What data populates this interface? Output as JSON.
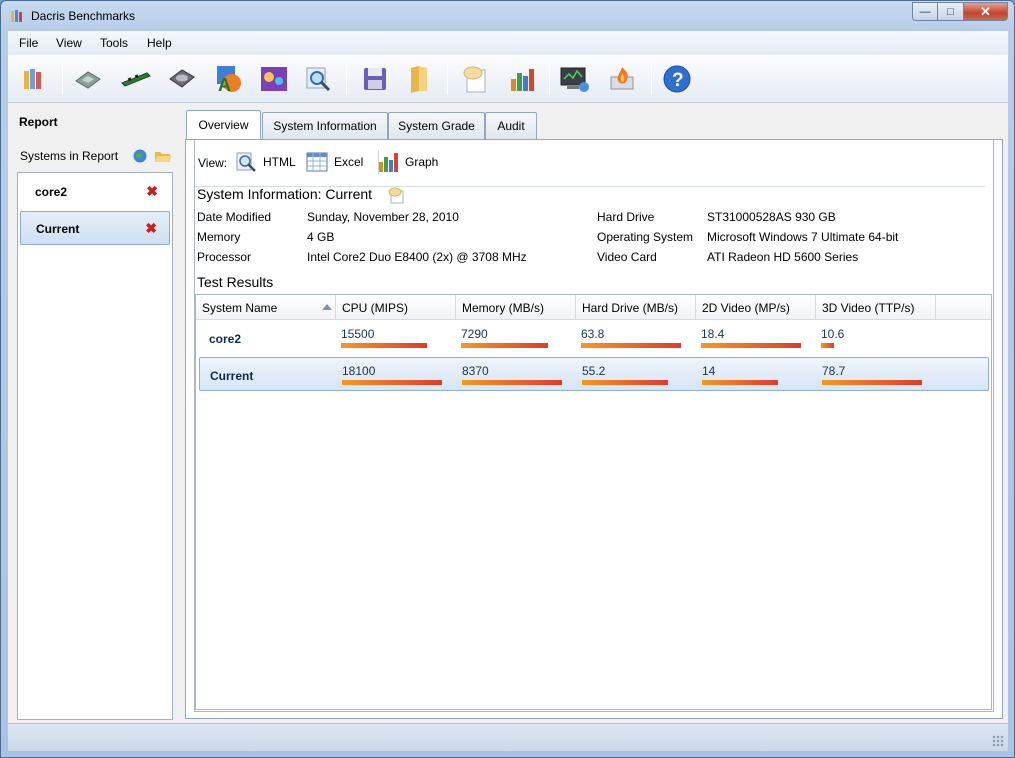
{
  "window": {
    "title": "Dacris Benchmarks"
  },
  "menu": {
    "file": "File",
    "view": "View",
    "tools": "Tools",
    "help": "Help"
  },
  "toolbar_icons": [
    "report-icon",
    "cpu-icon",
    "memory-icon",
    "hard-drive-icon",
    "2d-video-icon",
    "3d-video-icon",
    "search-icon",
    "save-icon",
    "open-folder-icon",
    "notes-icon",
    "graph-icon",
    "monitor-icon",
    "burn-in-icon",
    "help-icon"
  ],
  "left": {
    "title": "Report",
    "systems_label": "Systems in Report",
    "systems": [
      {
        "name": "core2",
        "selected": false
      },
      {
        "name": "Current",
        "selected": true
      }
    ]
  },
  "tabs": [
    "Overview",
    "System Information",
    "System Grade",
    "Audit"
  ],
  "view": {
    "label": "View:",
    "html": "HTML",
    "excel": "Excel",
    "graph": "Graph"
  },
  "sysinfo": {
    "title": "System Information: Current",
    "left": [
      {
        "label": "Date Modified",
        "value": "Sunday, November 28, 2010"
      },
      {
        "label": "Memory",
        "value": "4 GB"
      },
      {
        "label": "Processor",
        "value": "Intel Core2 Duo E8400 (2x) @ 3708 MHz"
      }
    ],
    "right": [
      {
        "label": "Hard Drive",
        "value": "ST31000528AS 930 GB"
      },
      {
        "label": "Operating System",
        "value": "Microsoft Windows 7 Ultimate 64-bit"
      },
      {
        "label": "Video Card",
        "value": "ATI Radeon HD 5600 Series"
      }
    ]
  },
  "results": {
    "title": "Test Results",
    "columns": [
      "System Name",
      "CPU (MIPS)",
      "Memory (MB/s)",
      "Hard Drive (MB/s)",
      "2D Video (MP/s)",
      "3D Video (TTP/s)"
    ],
    "rows": [
      {
        "name": "core2",
        "selected": false,
        "values": [
          "15500",
          "7290",
          "63.8",
          "18.4",
          "10.6"
        ],
        "fractions": [
          0.86,
          0.87,
          1.0,
          1.0,
          0.13
        ]
      },
      {
        "name": "Current",
        "selected": true,
        "values": [
          "18100",
          "8370",
          "55.2",
          "14",
          "78.7"
        ],
        "fractions": [
          1.0,
          1.0,
          0.86,
          0.76,
          1.0
        ]
      }
    ]
  },
  "colors": {
    "bar_start": "#f49a1e",
    "bar_end": "#e23a2a",
    "delete": "#d21a1a"
  }
}
